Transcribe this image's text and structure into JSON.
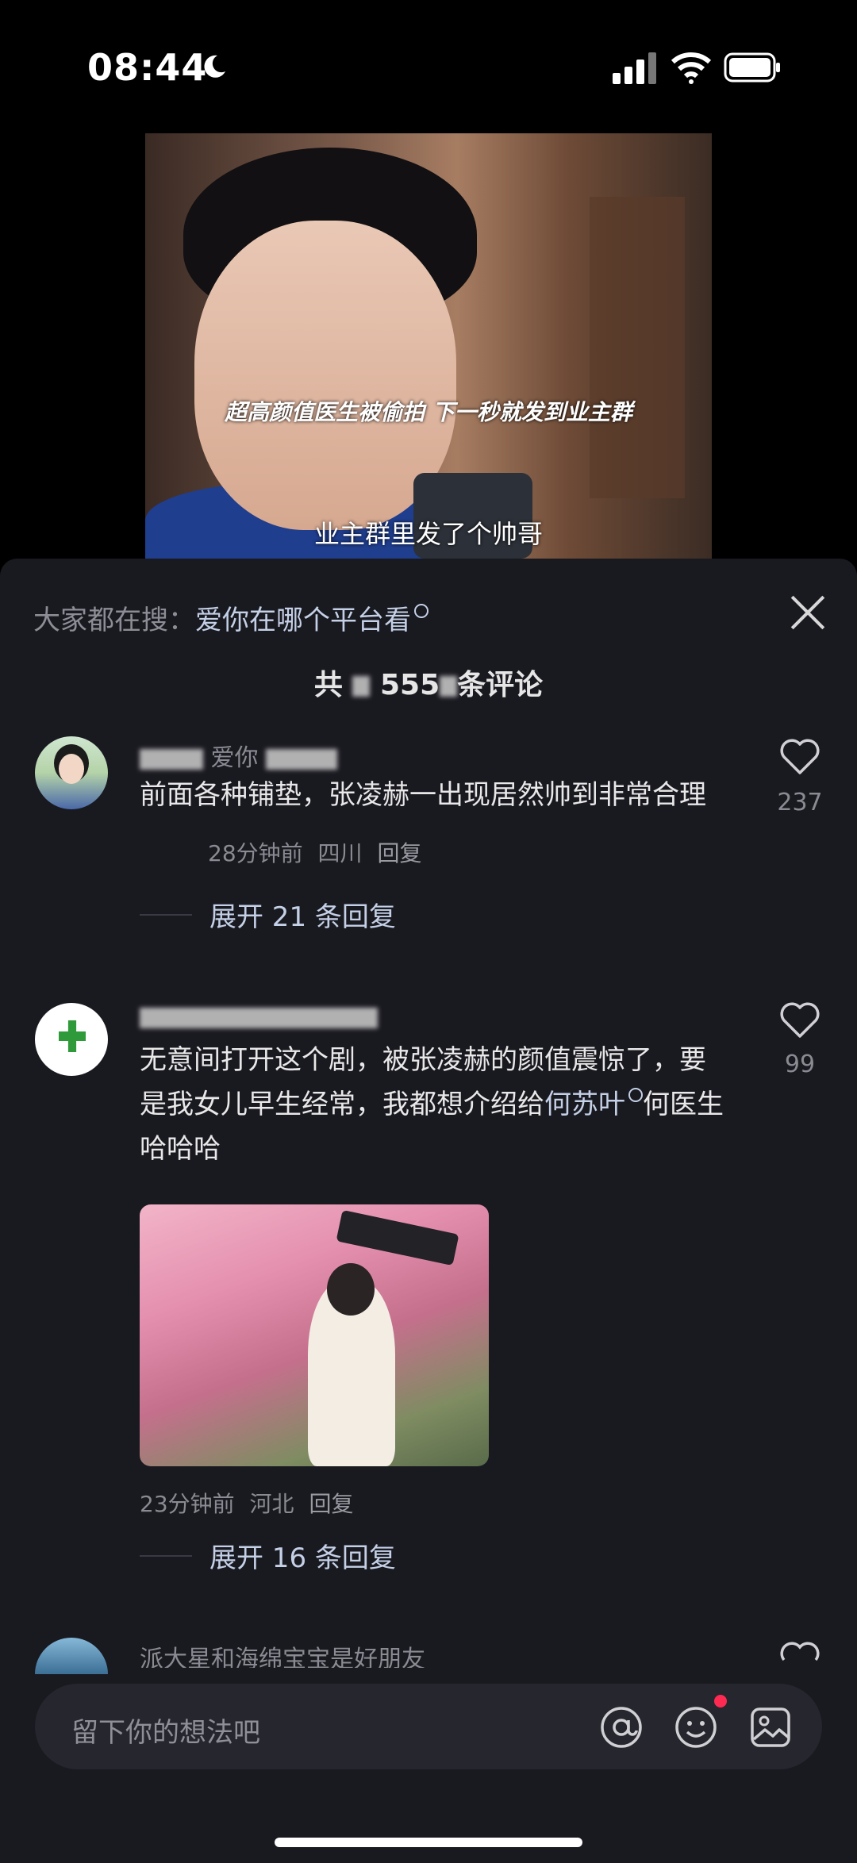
{
  "status_bar": {
    "time": "08:44"
  },
  "video": {
    "caption_top": "超高颜值医生被偷拍 下一秒就发到业主群",
    "caption_bottom": "业主群里发了个帅哥"
  },
  "comments_sheet": {
    "search_prefix": "大家都在搜：",
    "search_keyword": "爱你在哪个平台看",
    "count_prefix": "共",
    "count_visible": "555",
    "count_suffix": "条评论",
    "comments": [
      {
        "username_visible": "爱你",
        "text": "前面各种铺垫，张凌赫一出现居然帅到非常合理",
        "time": "28分钟前",
        "location": "四川",
        "reply_label": "回复",
        "likes": "237",
        "expand_label": "展开 21 条回复"
      },
      {
        "text_before": "无意间打开这个剧，被张凌赫的颜值震惊了，要是我女儿早生经常，我都想介绍给",
        "link1": "何苏叶",
        "text_after": "何医生哈哈哈",
        "time": "23分钟前",
        "location": "河北",
        "reply_label": "回复",
        "likes": "99",
        "expand_label": "展开 16 条回复"
      },
      {
        "username": "派大星和海绵宝宝是好朋友"
      }
    ]
  },
  "input_bar": {
    "placeholder": "留下你的想法吧"
  },
  "colors": {
    "sheet_bg": "#191920",
    "link": "#c4d0e6",
    "notification_dot": "#ff2a52"
  }
}
